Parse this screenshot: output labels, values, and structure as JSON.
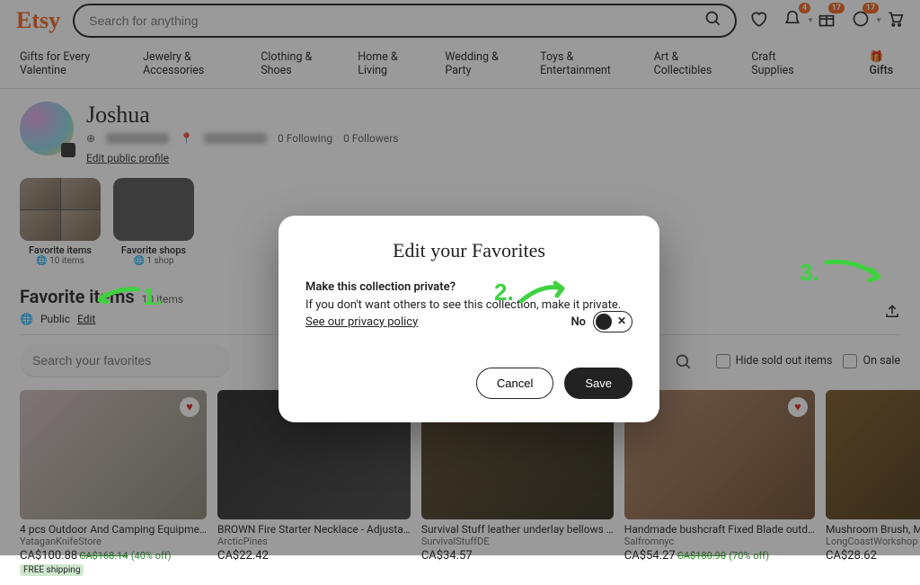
{
  "header": {
    "logo": "Etsy",
    "search_placeholder": "Search for anything",
    "badges": {
      "bell": "4",
      "gift": "17",
      "updates": "17"
    }
  },
  "nav": {
    "items": [
      "Gifts for Every Valentine",
      "Jewelry & Accessories",
      "Clothing & Shoes",
      "Home & Living",
      "Wedding & Party",
      "Toys & Entertainment",
      "Art & Collectibles",
      "Craft Supplies"
    ],
    "gifts": "Gifts"
  },
  "profile": {
    "name": "Joshua",
    "following": "0 Following",
    "followers": "0 Followers",
    "edit_link": "Edit public profile"
  },
  "collections": [
    {
      "title": "Favorite items",
      "sub": "10 items",
      "selected": true
    },
    {
      "title": "Favorite shops",
      "sub": "1 shop",
      "selected": false
    }
  ],
  "section": {
    "title": "Favorite items",
    "count": "10 items",
    "visibility": "Public",
    "edit": "Edit",
    "search_placeholder": "Search your favorites",
    "hide_sold": "Hide sold out items",
    "on_sale": "On sale"
  },
  "items": [
    {
      "title": "4 pcs Outdoor And Camping Equipme…",
      "shop": "YataganKnifeStore",
      "price": "CA$100.88",
      "orig": "CA$168.14",
      "off": "(40% off)",
      "freeship": "FREE shipping"
    },
    {
      "title": "BROWN Fire Starter Necklace - Adjusta…",
      "shop": "ArcticPines",
      "price": "CA$22.42",
      "orig": "",
      "off": "",
      "freeship": ""
    },
    {
      "title": "Survival Stuff leather underlay bellows …",
      "shop": "SurvivalStuffDE",
      "price": "CA$34.57",
      "orig": "",
      "off": "",
      "freeship": ""
    },
    {
      "title": "Handmade bushcraft Fixed Blade outd…",
      "shop": "Salfromnyc",
      "price": "CA$54.27",
      "orig": "CA$180.90",
      "off": "(70% off)",
      "freeship": ""
    },
    {
      "title": "Mushroom Brush, Mushroom Picking, F…",
      "shop": "LongCoastWorkshop",
      "price": "CA$28.62",
      "orig": "",
      "off": "",
      "freeship": ""
    }
  ],
  "modal": {
    "title": "Edit your Favorites",
    "question": "Make this collection private?",
    "desc1": "If you don't want others to see this collection, make it private. ",
    "policy": "See our privacy policy",
    "toggle_label": "No",
    "cancel": "Cancel",
    "save": "Save"
  },
  "annotations": {
    "one": "1.",
    "two": "2.",
    "three": "3."
  }
}
